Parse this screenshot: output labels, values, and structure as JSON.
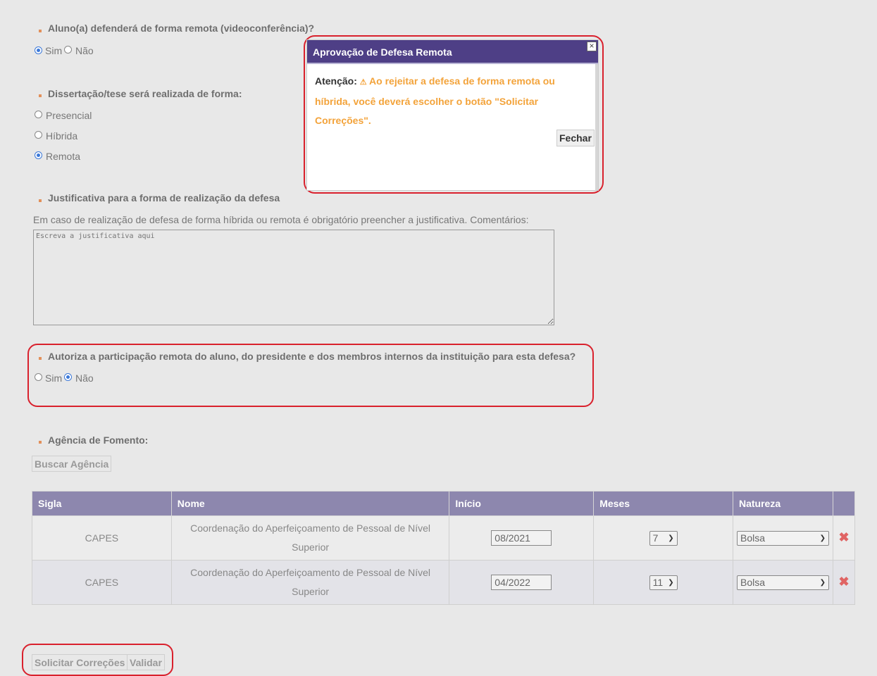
{
  "q_remote": {
    "title": "Aluno(a) defenderá de forma remota (videoconferência)?",
    "options": [
      "Sim",
      "Não"
    ],
    "selected": "Sim"
  },
  "q_form": {
    "title": "Dissertação/tese será realizada de forma:",
    "options": [
      "Presencial",
      "Híbrida",
      "Remota"
    ],
    "selected": "Remota"
  },
  "q_justification": {
    "title": "Justificativa para a forma de realização da defesa",
    "hint": "Em caso de realização de defesa de forma híbrida ou remota é obrigatório preencher a justificativa. Comentários:",
    "placeholder": "Escreva a justificativa aqui"
  },
  "q_authorize": {
    "title": "Autoriza a participação remota do aluno, do presidente e dos membros internos da instituição para esta defesa?",
    "options": [
      "Sim",
      "Não"
    ],
    "selected": "Não"
  },
  "agency": {
    "title": "Agência de Fomento:",
    "search_button": "Buscar Agência",
    "columns": [
      "Sigla",
      "Nome",
      "Início",
      "Meses",
      "Natureza",
      ""
    ],
    "rows": [
      {
        "sigla": "CAPES",
        "nome": "Coordenação do Aperfeiçoamento de Pessoal de Nível Superior",
        "inicio": "08/2021",
        "meses": "7",
        "natureza": "Bolsa"
      },
      {
        "sigla": "CAPES",
        "nome": "Coordenação do Aperfeiçoamento de Pessoal de Nível Superior",
        "inicio": "04/2022",
        "meses": "11",
        "natureza": "Bolsa"
      }
    ]
  },
  "actions": {
    "request_corrections": "Solicitar Correções",
    "validate": "Validar"
  },
  "dialog": {
    "title": "Aprovação de Defesa Remota",
    "close_glyph": "×",
    "attention_label": "Atenção:",
    "warning_glyph": "⚠",
    "warning_text": "Ao rejeitar a defesa de forma remota ou híbrida, você deverá escolher o botão \"Solicitar Correções\".",
    "close_button": "Fechar"
  },
  "colors": {
    "highlight": "#d9212d",
    "dialog_title_bg": "#4e3f86",
    "table_header_bg": "#8d87ae",
    "warning": "#f3a33a",
    "bullet": "#e2905a"
  }
}
